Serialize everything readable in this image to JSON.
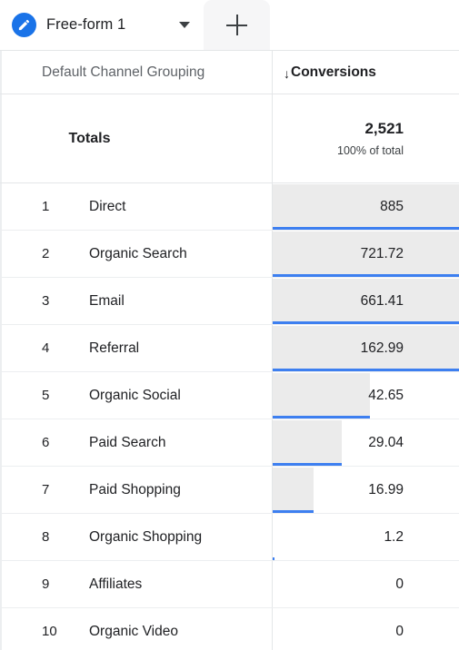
{
  "tab_bar": {
    "active_tab": {
      "icon": "pencil-icon",
      "label": "Free-form 1",
      "dropdown_icon": "chevron-down-icon"
    },
    "add_tab": {
      "icon": "plus-icon",
      "label": "+"
    }
  },
  "table": {
    "headers": {
      "dimension": "Default Channel Grouping",
      "metric": "Conversions",
      "sort_indicator": "↓"
    },
    "totals": {
      "label": "Totals",
      "value": "2,521",
      "subtext": "100% of total"
    },
    "rows": [
      {
        "rank": "1",
        "dimension": "Direct",
        "value": "885",
        "bar_pct": 100
      },
      {
        "rank": "2",
        "dimension": "Organic Search",
        "value": "721.72",
        "bar_pct": 100
      },
      {
        "rank": "3",
        "dimension": "Email",
        "value": "661.41",
        "bar_pct": 100
      },
      {
        "rank": "4",
        "dimension": "Referral",
        "value": "162.99",
        "bar_pct": 100
      },
      {
        "rank": "5",
        "dimension": "Organic Social",
        "value": "42.65",
        "bar_pct": 52
      },
      {
        "rank": "6",
        "dimension": "Paid Search",
        "value": "29.04",
        "bar_pct": 37
      },
      {
        "rank": "7",
        "dimension": "Paid Shopping",
        "value": "16.99",
        "bar_pct": 22
      },
      {
        "rank": "8",
        "dimension": "Organic Shopping",
        "value": "1.2",
        "bar_pct": 1
      },
      {
        "rank": "9",
        "dimension": "Affiliates",
        "value": "0",
        "bar_pct": 0
      },
      {
        "rank": "10",
        "dimension": "Organic Video",
        "value": "0",
        "bar_pct": 0
      }
    ]
  },
  "chart_data": {
    "type": "bar",
    "title": "Conversions by Default Channel Grouping",
    "xlabel": "Conversions",
    "ylabel": "Default Channel Grouping",
    "categories": [
      "Direct",
      "Organic Search",
      "Email",
      "Referral",
      "Organic Social",
      "Paid Search",
      "Paid Shopping",
      "Organic Shopping",
      "Affiliates",
      "Organic Video"
    ],
    "values": [
      885,
      721.72,
      661.41,
      162.99,
      42.65,
      29.04,
      16.99,
      1.2,
      0,
      0
    ],
    "total": 2521,
    "total_label": "100% of total",
    "orientation": "horizontal",
    "grid": false,
    "legend": "none",
    "bar_color": "#ebebeb",
    "accent_color": "#3d7ff0"
  },
  "colors": {
    "brand_blue": "#1a73e8",
    "bar_underline": "#3d7ff0",
    "bar_fill": "#ebebeb",
    "text_primary": "#202124",
    "text_secondary": "#5f6368",
    "divider": "#e4e6e8"
  }
}
